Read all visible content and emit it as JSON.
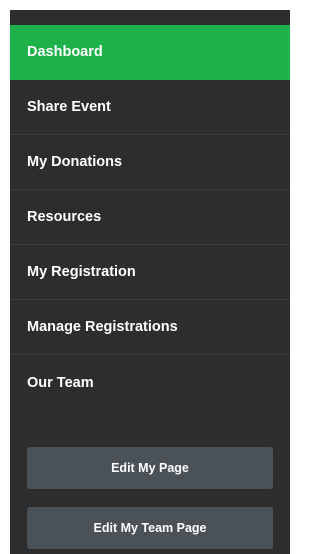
{
  "sidebar": {
    "items": [
      {
        "label": "Dashboard",
        "active": true
      },
      {
        "label": "Share Event"
      },
      {
        "label": "My Donations"
      },
      {
        "label": "Resources"
      },
      {
        "label": "My Registration"
      },
      {
        "label": "Manage Registrations"
      },
      {
        "label": "Our Team"
      }
    ],
    "buttons": {
      "edit_my_page": "Edit My Page",
      "edit_my_team_page": "Edit My Team Page"
    }
  },
  "colors": {
    "sidebar_bg": "#2d2d2d",
    "active_bg": "#1fb24a",
    "button_bg": "#4a5257",
    "text": "#ffffff"
  }
}
